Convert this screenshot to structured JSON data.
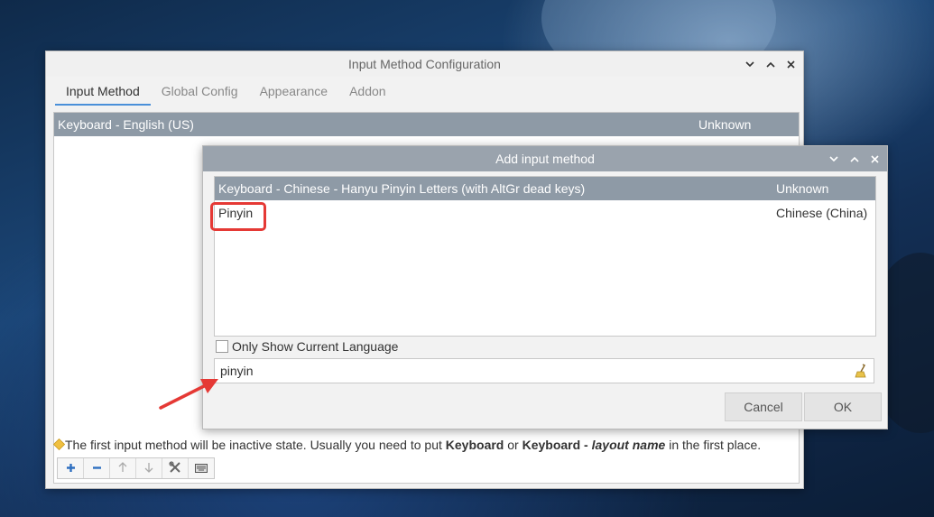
{
  "main_window": {
    "title": "Input Method Configuration",
    "tabs": [
      {
        "label": "Input Method"
      },
      {
        "label": "Global Config"
      },
      {
        "label": "Appearance"
      },
      {
        "label": "Addon"
      }
    ],
    "list": [
      {
        "name": "Keyboard - English (US)",
        "language": "Unknown"
      }
    ],
    "hint": {
      "pre": "The first input method will be inactive state. Usually you need to put ",
      "kw1": "Keyboard",
      "mid": " or ",
      "kw2a": "Keyboard - ",
      "kw2b": "layout name",
      "post": " in the first place."
    }
  },
  "dialog": {
    "title": "Add input method",
    "items": [
      {
        "name": "Keyboard - Chinese - Hanyu Pinyin Letters (with AltGr dead keys)",
        "language": "Unknown"
      },
      {
        "name": "Pinyin",
        "language": "Chinese (China)"
      }
    ],
    "only_current_label": "Only Show Current Language",
    "search_value": "pinyin",
    "cancel_label": "Cancel",
    "ok_label": "OK"
  },
  "colors": {
    "selection": "#8e9aa6",
    "highlight": "#e53935",
    "arrow": "#e53935",
    "accent": "#4a90d9"
  },
  "icons": [
    "chevron-down-icon",
    "chevron-up-icon",
    "close-icon",
    "add-icon",
    "remove-icon",
    "move-up-icon",
    "move-down-icon",
    "configure-icon",
    "keyboard-layout-icon",
    "clear-icon",
    "hint-icon"
  ]
}
